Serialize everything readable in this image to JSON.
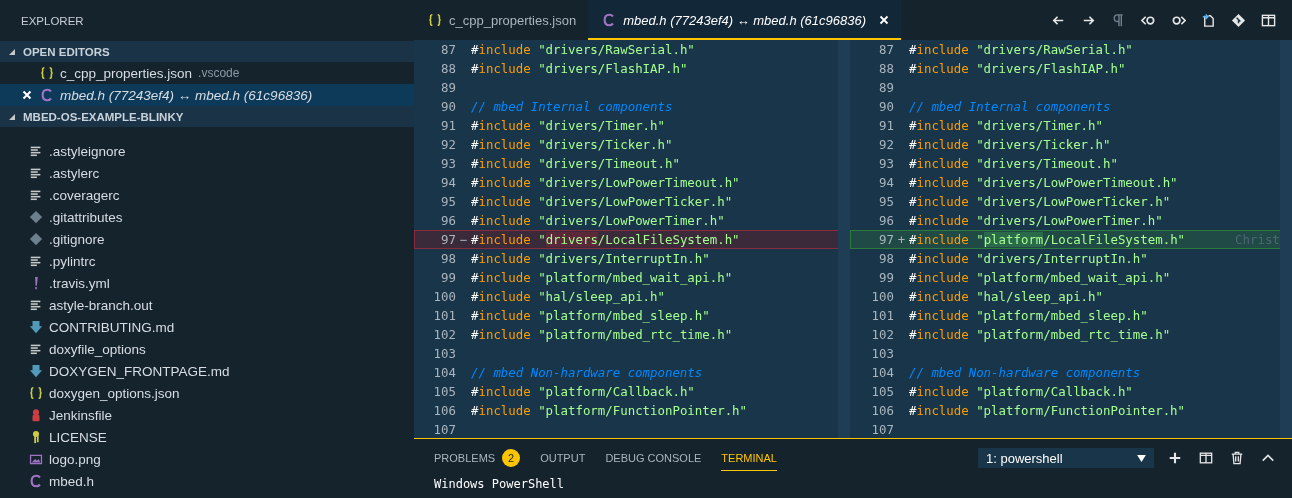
{
  "sidebar": {
    "title": "EXPLORER",
    "open_editors": {
      "title": "OPEN EDITORS",
      "expanded": true,
      "items": [
        {
          "kind": "json",
          "label": "c_cpp_properties.json",
          "description": ".vscode",
          "selected": false,
          "italic": false
        },
        {
          "kind": "c",
          "label": "mbed.h (77243ef4) ↔ mbed.h (61c96836)",
          "selected": true,
          "italic": true
        }
      ]
    },
    "folder": {
      "title": "MBED-OS-EXAMPLE-BLINKY",
      "expanded": true,
      "items": [
        {
          "kind": "text",
          "label": ".astyleignore"
        },
        {
          "kind": "text",
          "label": ".astylerc"
        },
        {
          "kind": "text",
          "label": ".coveragerc"
        },
        {
          "kind": "git",
          "label": ".gitattributes"
        },
        {
          "kind": "git",
          "label": ".gitignore"
        },
        {
          "kind": "text",
          "label": ".pylintrc"
        },
        {
          "kind": "yaml",
          "label": ".travis.yml"
        },
        {
          "kind": "text",
          "label": "astyle-branch.out"
        },
        {
          "kind": "markdown",
          "label": "CONTRIBUTING.md"
        },
        {
          "kind": "text",
          "label": "doxyfile_options"
        },
        {
          "kind": "markdown",
          "label": "DOXYGEN_FRONTPAGE.md"
        },
        {
          "kind": "json",
          "label": "doxygen_options.json"
        },
        {
          "kind": "jenkins",
          "label": "Jenkinsfile"
        },
        {
          "kind": "license",
          "label": "LICENSE"
        },
        {
          "kind": "image",
          "label": "logo.png"
        },
        {
          "kind": "c",
          "label": "mbed.h"
        }
      ]
    }
  },
  "tabs": [
    {
      "kind": "json",
      "label": "c_cpp_properties.json",
      "selected": false,
      "italic": false
    },
    {
      "kind": "c",
      "label": "mbed.h (77243ef4) ↔ mbed.h (61c96836)",
      "selected": true,
      "italic": true
    }
  ],
  "diff": {
    "left": [
      {
        "num": "87",
        "kind": "include",
        "hash": "#",
        "keyword": "include",
        "string": "\"drivers/RawSerial.h\""
      },
      {
        "num": "88",
        "kind": "include",
        "hash": "#",
        "keyword": "include",
        "string": "\"drivers/FlashIAP.h\""
      },
      {
        "num": "89",
        "kind": "blank"
      },
      {
        "num": "90",
        "kind": "comment",
        "text": "// mbed Internal components"
      },
      {
        "num": "91",
        "kind": "include",
        "hash": "#",
        "keyword": "include",
        "string": "\"drivers/Timer.h\""
      },
      {
        "num": "92",
        "kind": "include",
        "hash": "#",
        "keyword": "include",
        "string": "\"drivers/Ticker.h\""
      },
      {
        "num": "93",
        "kind": "include",
        "hash": "#",
        "keyword": "include",
        "string": "\"drivers/Timeout.h\""
      },
      {
        "num": "94",
        "kind": "include",
        "hash": "#",
        "keyword": "include",
        "string": "\"drivers/LowPowerTimeout.h\""
      },
      {
        "num": "95",
        "kind": "include",
        "hash": "#",
        "keyword": "include",
        "string": "\"drivers/LowPowerTicker.h\""
      },
      {
        "num": "96",
        "kind": "include",
        "hash": "#",
        "keyword": "include",
        "string": "\"drivers/LowPowerTimer.h\""
      },
      {
        "num": "97",
        "kind": "removed",
        "marker": "−",
        "hash": "#",
        "keyword": "include",
        "segments": [
          {
            "text": "\"",
            "changed": false
          },
          {
            "text": "drivers",
            "changed": true
          },
          {
            "text": "/LocalFileSystem.h\"",
            "changed": false
          }
        ]
      },
      {
        "num": "98",
        "kind": "include",
        "hash": "#",
        "keyword": "include",
        "string": "\"drivers/InterruptIn.h\""
      },
      {
        "num": "99",
        "kind": "include",
        "hash": "#",
        "keyword": "include",
        "string": "\"platform/mbed_wait_api.h\""
      },
      {
        "num": "100",
        "kind": "include",
        "hash": "#",
        "keyword": "include",
        "string": "\"hal/sleep_api.h\""
      },
      {
        "num": "101",
        "kind": "include",
        "hash": "#",
        "keyword": "include",
        "string": "\"platform/mbed_sleep.h\""
      },
      {
        "num": "102",
        "kind": "include",
        "hash": "#",
        "keyword": "include",
        "string": "\"platform/mbed_rtc_time.h\""
      },
      {
        "num": "103",
        "kind": "blank"
      },
      {
        "num": "104",
        "kind": "comment",
        "text": "// mbed Non-hardware components"
      },
      {
        "num": "105",
        "kind": "include",
        "hash": "#",
        "keyword": "include",
        "string": "\"platform/Callback.h\""
      },
      {
        "num": "106",
        "kind": "include",
        "hash": "#",
        "keyword": "include",
        "string": "\"platform/FunctionPointer.h\""
      },
      {
        "num": "107",
        "kind": "blank"
      }
    ],
    "right": [
      {
        "num": "87",
        "kind": "include",
        "hash": "#",
        "keyword": "include",
        "string": "\"drivers/RawSerial.h\""
      },
      {
        "num": "88",
        "kind": "include",
        "hash": "#",
        "keyword": "include",
        "string": "\"drivers/FlashIAP.h\""
      },
      {
        "num": "89",
        "kind": "blank"
      },
      {
        "num": "90",
        "kind": "comment",
        "text": "// mbed Internal components"
      },
      {
        "num": "91",
        "kind": "include",
        "hash": "#",
        "keyword": "include",
        "string": "\"drivers/Timer.h\""
      },
      {
        "num": "92",
        "kind": "include",
        "hash": "#",
        "keyword": "include",
        "string": "\"drivers/Ticker.h\""
      },
      {
        "num": "93",
        "kind": "include",
        "hash": "#",
        "keyword": "include",
        "string": "\"drivers/Timeout.h\""
      },
      {
        "num": "94",
        "kind": "include",
        "hash": "#",
        "keyword": "include",
        "string": "\"drivers/LowPowerTimeout.h\""
      },
      {
        "num": "95",
        "kind": "include",
        "hash": "#",
        "keyword": "include",
        "string": "\"drivers/LowPowerTicker.h\""
      },
      {
        "num": "96",
        "kind": "include",
        "hash": "#",
        "keyword": "include",
        "string": "\"drivers/LowPowerTimer.h\""
      },
      {
        "num": "97",
        "kind": "added",
        "marker": "+",
        "hash": "#",
        "keyword": "include",
        "segments": [
          {
            "text": "\"",
            "changed": false
          },
          {
            "text": "platform",
            "changed": true
          },
          {
            "text": "/LocalFileSystem.h\"",
            "changed": false
          }
        ],
        "annotation": "Christ"
      },
      {
        "num": "98",
        "kind": "include",
        "hash": "#",
        "keyword": "include",
        "string": "\"drivers/InterruptIn.h\""
      },
      {
        "num": "99",
        "kind": "include",
        "hash": "#",
        "keyword": "include",
        "string": "\"platform/mbed_wait_api.h\""
      },
      {
        "num": "100",
        "kind": "include",
        "hash": "#",
        "keyword": "include",
        "string": "\"hal/sleep_api.h\""
      },
      {
        "num": "101",
        "kind": "include",
        "hash": "#",
        "keyword": "include",
        "string": "\"platform/mbed_sleep.h\""
      },
      {
        "num": "102",
        "kind": "include",
        "hash": "#",
        "keyword": "include",
        "string": "\"platform/mbed_rtc_time.h\""
      },
      {
        "num": "103",
        "kind": "blank"
      },
      {
        "num": "104",
        "kind": "comment",
        "text": "// mbed Non-hardware components"
      },
      {
        "num": "105",
        "kind": "include",
        "hash": "#",
        "keyword": "include",
        "string": "\"platform/Callback.h\""
      },
      {
        "num": "106",
        "kind": "include",
        "hash": "#",
        "keyword": "include",
        "string": "\"platform/FunctionPointer.h\""
      },
      {
        "num": "107",
        "kind": "blank"
      }
    ]
  },
  "panel": {
    "tabs": [
      {
        "label": "PROBLEMS",
        "badge": "2",
        "selected": false
      },
      {
        "label": "OUTPUT",
        "selected": false
      },
      {
        "label": "DEBUG CONSOLE",
        "selected": false
      },
      {
        "label": "TERMINAL",
        "selected": true
      }
    ],
    "terminal_select": "1: powershell",
    "terminal_lines": [
      "Windows PowerShell"
    ]
  }
}
